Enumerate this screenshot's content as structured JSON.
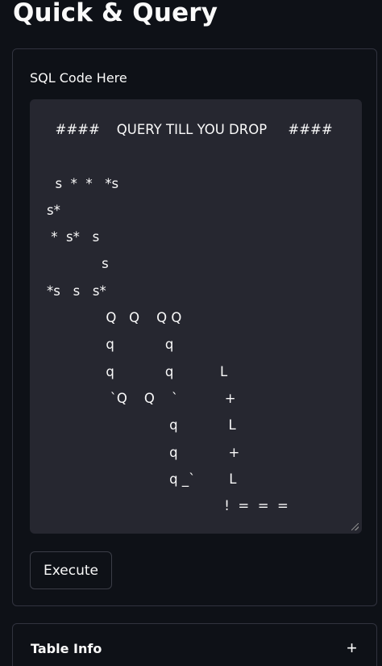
{
  "app": {
    "title": "Quick & Query"
  },
  "form": {
    "code_label": "SQL Code Here",
    "code_value": "  ####    QUERY TILL YOU DROP     ####\n\n  s  *  *   *s\ns*\n *  s*   s\n             s\n*s   s   s*\n              Q   Q    Q Q\n              q            q\n              q            q           L\n               `Q    Q    `           +\n                             q            L\n                             q            +\n                             q _`        L\n                                          !  =  =  =",
    "execute_label": "Execute"
  },
  "expander": {
    "label": "Table Info",
    "icon": "plus-icon",
    "icon_glyph": "+"
  },
  "colors": {
    "background": "#0e1117",
    "code_background": "#262730",
    "border": "#31333f",
    "text": "#fafafa"
  }
}
